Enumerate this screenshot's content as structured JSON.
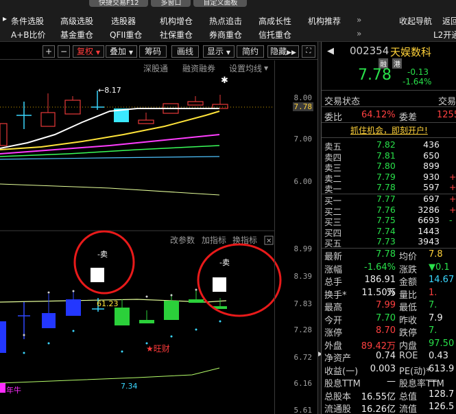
{
  "tabs": [
    "快捷交易F12",
    "多窗口",
    "自定义面板"
  ],
  "menu_row1": [
    "条件选股",
    "高级选股",
    "选股器",
    "机构增仓",
    "热点追击",
    "高成长性",
    "机构推荐",
    "收起导航",
    "返回"
  ],
  "menu_row2": [
    "A+B比价",
    "基金重仓",
    "QFII重仓",
    "社保重仓",
    "券商重仓",
    "信托重仓",
    "L2开通"
  ],
  "toolbar": {
    "plus": "+",
    "minus": "−",
    "fuquan": "复权",
    "diejia": "叠加",
    "chouma": "筹码",
    "huaxian": "画线",
    "xianshi": "显示",
    "jianyue": "简约",
    "yincang": "隐藏",
    "sub_links": [
      "深股通",
      "融资融券",
      "设置均线"
    ]
  },
  "price_axis_main": [
    "8.00",
    "7.78",
    "7.00",
    "6.00"
  ],
  "price_axis_sub": [
    "8.99",
    "8.39",
    "7.83",
    "7.28",
    "6.72",
    "6.16",
    "5.61"
  ],
  "chart_labels": {
    "high_marker": "8.17",
    "sub_toolbar": [
      "改参数",
      "加指标",
      "换指标"
    ],
    "sell1": "-卖",
    "sell2": "-卖",
    "value_6123": "61.23",
    "wangcai": "旺财",
    "value_734": "7.34",
    "nianniu": "年牛"
  },
  "stock": {
    "code": "002354",
    "name": "天娱数科",
    "badges": [
      "融",
      "港"
    ],
    "price": "7.78",
    "change": "-0.13",
    "change_pct": "-1.64%"
  },
  "trade_status": {
    "label": "交易状态",
    "right": "交易"
  },
  "weibi": {
    "label": "委比",
    "value": "64.12%",
    "label2": "委差",
    "value2": "1255"
  },
  "promo": "抓住机会，即刻开户!",
  "asks": [
    {
      "label": "卖五",
      "price": "7.82",
      "vol": "436",
      "extra": ""
    },
    {
      "label": "卖四",
      "price": "7.81",
      "vol": "650",
      "extra": ""
    },
    {
      "label": "卖三",
      "price": "7.80",
      "vol": "899",
      "extra": ""
    },
    {
      "label": "卖二",
      "price": "7.79",
      "vol": "930",
      "extra": "+"
    },
    {
      "label": "卖一",
      "price": "7.78",
      "vol": "597",
      "extra": "+"
    }
  ],
  "bids": [
    {
      "label": "买一",
      "price": "7.77",
      "vol": "697",
      "extra": "+"
    },
    {
      "label": "买二",
      "price": "7.76",
      "vol": "3286",
      "extra": "+"
    },
    {
      "label": "买三",
      "price": "7.75",
      "vol": "6693",
      "extra": "-"
    },
    {
      "label": "买四",
      "price": "7.74",
      "vol": "1443",
      "extra": ""
    },
    {
      "label": "买五",
      "price": "7.73",
      "vol": "3943",
      "extra": ""
    }
  ],
  "stats": [
    {
      "l1": "最新",
      "v1": "7.78",
      "c1": "g",
      "l2": "均价",
      "v2": "7.8",
      "c2": "y"
    },
    {
      "l1": "涨幅",
      "v1": "-1.64%",
      "c1": "g",
      "l2": "涨跌",
      "v2": "▼0.1",
      "c2": "g"
    },
    {
      "l1": "总手",
      "v1": "186.91万",
      "c1": "w",
      "l2": "金额",
      "v2": "14.67",
      "c2": "c"
    },
    {
      "l1": "换手*",
      "v1": "11.50%",
      "c1": "w",
      "l2": "量比",
      "v2": "1.",
      "c2": "r"
    },
    {
      "l1": "最高",
      "v1": "7.99",
      "c1": "r",
      "l2": "最低",
      "v2": "7.",
      "c2": "g"
    },
    {
      "l1": "今开",
      "v1": "7.70",
      "c1": "g",
      "l2": "昨收",
      "v2": "7.9",
      "c2": "w"
    },
    {
      "l1": "涨停",
      "v1": "8.70",
      "c1": "r",
      "l2": "跌停",
      "v2": "7.",
      "c2": "g"
    },
    {
      "l1": "外盘",
      "v1": "89.42万",
      "c1": "r",
      "l2": "内盘",
      "v2": "97.50",
      "c2": "g"
    },
    {
      "l1": "净资产",
      "v1": "0.74",
      "c1": "w",
      "l2": "ROE",
      "v2": "0.43",
      "c2": "w"
    },
    {
      "l1": "收益(一)",
      "v1": "0.003",
      "c1": "w",
      "l2": "PE(动)*",
      "v2": "613.9",
      "c2": "w"
    },
    {
      "l1": "股息TTM",
      "v1": "—",
      "c1": "w",
      "l2": "股息率TTM",
      "v2": "—",
      "c2": "w"
    },
    {
      "l1": "总股本",
      "v1": "16.55亿",
      "c1": "w",
      "l2": "总值",
      "v2": "128.7",
      "c2": "w"
    },
    {
      "l1": "流通股",
      "v1": "16.26亿",
      "c1": "w",
      "l2": "流值",
      "v2": "126.5",
      "c2": "w"
    }
  ]
}
